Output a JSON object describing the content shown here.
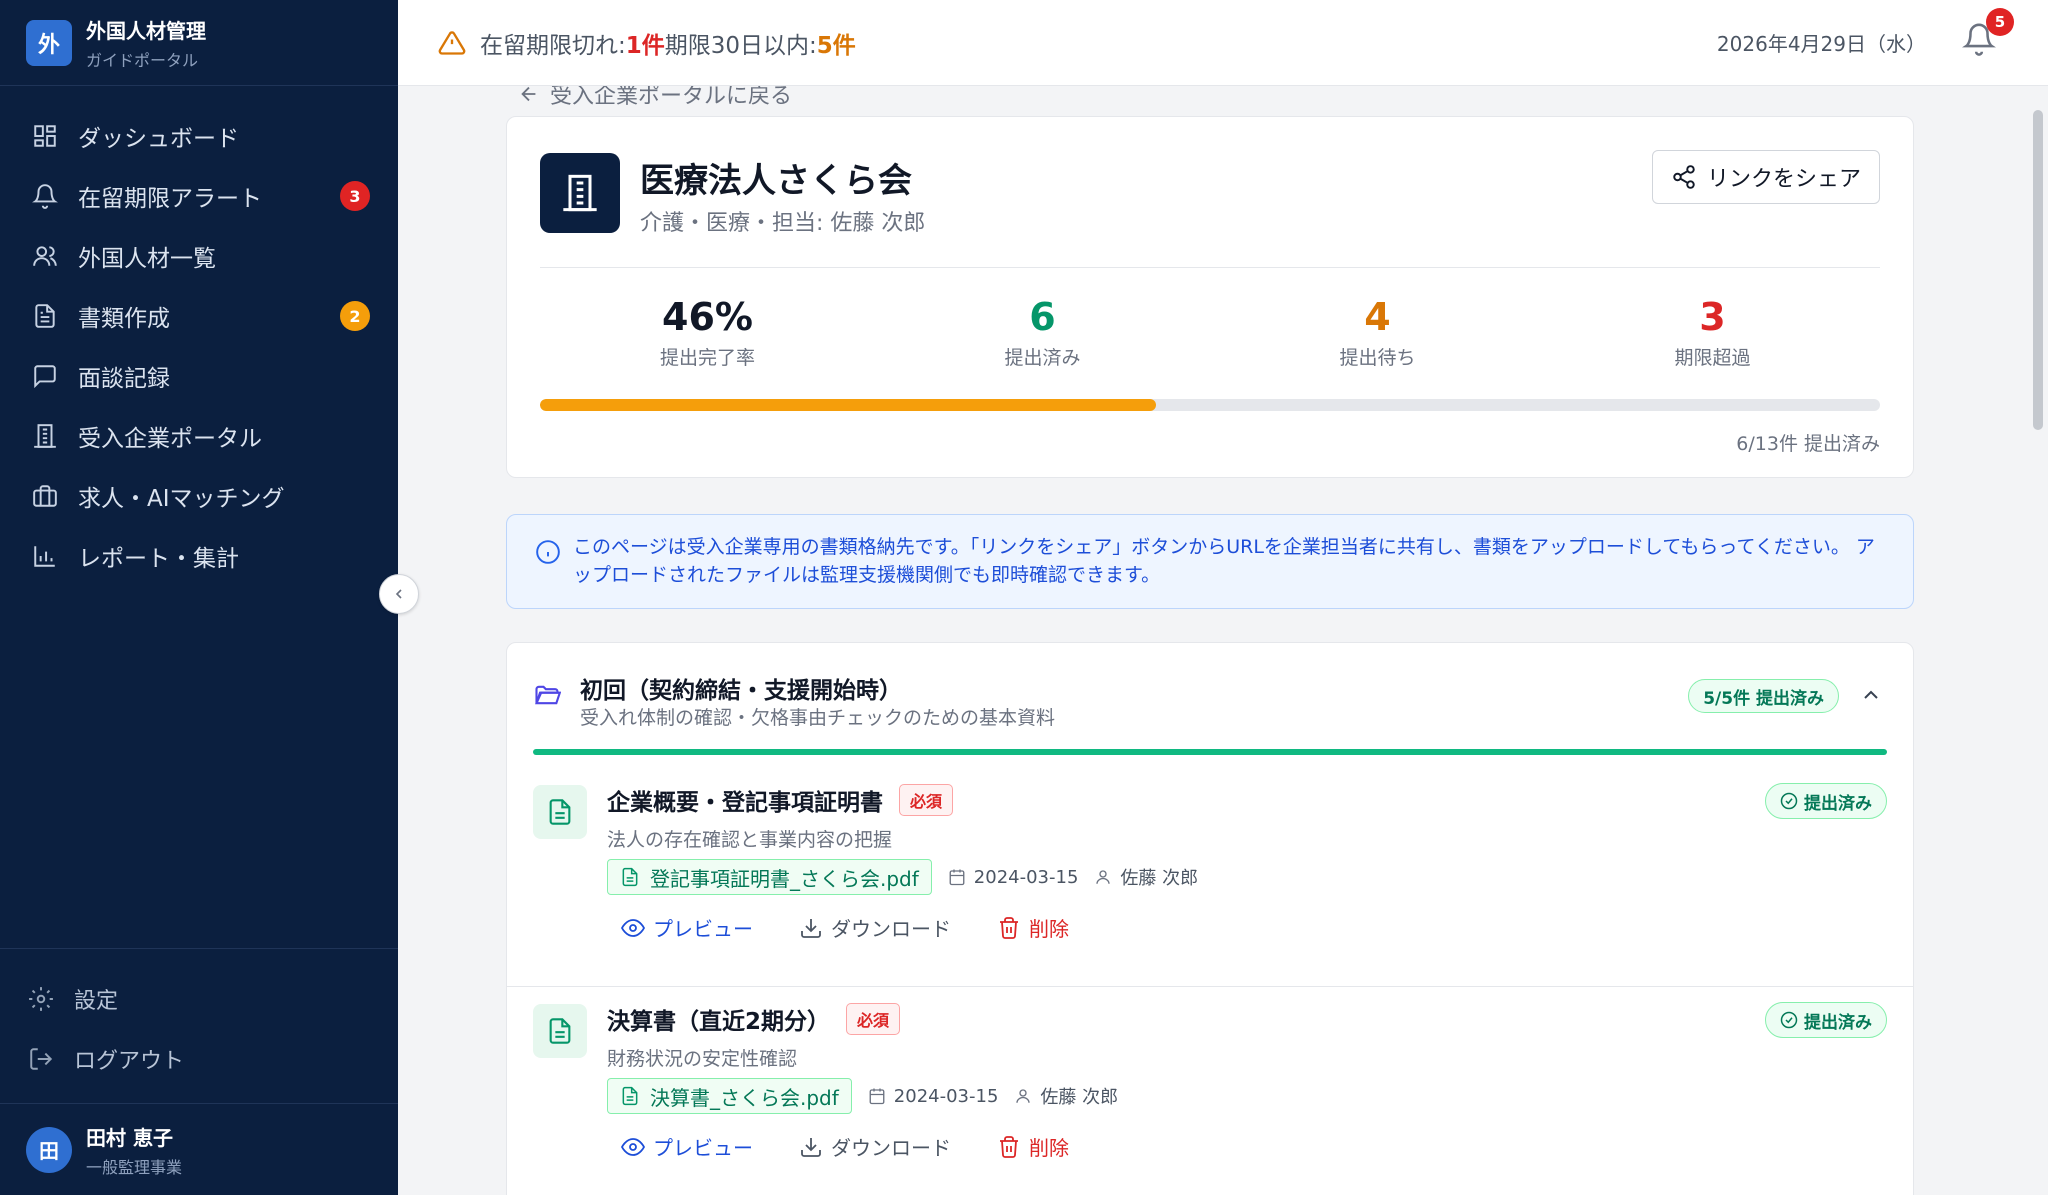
{
  "brand": {
    "logo": "外",
    "title": "外国人材管理",
    "subtitle": "ガイドポータル"
  },
  "sidebar": {
    "items": [
      {
        "label": "ダッシュボード",
        "icon": "dashboard-icon"
      },
      {
        "label": "在留期限アラート",
        "icon": "bell-icon",
        "badge": "3"
      },
      {
        "label": "外国人材一覧",
        "icon": "users-icon"
      },
      {
        "label": "書類作成",
        "icon": "document-icon",
        "badge": "2"
      },
      {
        "label": "面談記録",
        "icon": "chat-icon"
      },
      {
        "label": "受入企業ポータル",
        "icon": "building-icon"
      },
      {
        "label": "求人・AIマッチング",
        "icon": "briefcase-icon"
      },
      {
        "label": "レポート・集計",
        "icon": "chart-icon"
      }
    ],
    "settings": "設定",
    "logout": "ログアウト",
    "user": {
      "initial": "田",
      "name": "田村 恵子",
      "role": "一般監理事業"
    }
  },
  "topbar": {
    "alert_prefix": "在留期限切れ: ",
    "expired": "1件",
    "soon_prefix": "期限30日以内: ",
    "soon": "5件",
    "date": "2026年4月29日（水）",
    "notifications": "5"
  },
  "main": {
    "back_link": "受入企業ポータルに戻る",
    "company": {
      "name": "医療法人さくら会",
      "subtitle": "介護・医療・担当: 佐藤 次郎",
      "share_label": "リンクをシェア"
    },
    "stats": [
      {
        "value": "46%",
        "label": "提出完了率",
        "color": "#111827"
      },
      {
        "value": "6",
        "label": "提出済み",
        "color": "#059669"
      },
      {
        "value": "4",
        "label": "提出待ち",
        "color": "#d97706"
      },
      {
        "value": "3",
        "label": "期限超過",
        "color": "#dc2626"
      }
    ],
    "progress": {
      "percent": 46,
      "caption": "6/13件 提出済み"
    },
    "info": "このページは受入企業専用の書類格納先です。「リンクをシェア」ボタンからURLを企業担当者に共有し、書類をアップロードしてもらってください。 アップロードされたファイルは監理支援機関側でも即時確認できます。",
    "section": {
      "title": "初回（契約締結・支援開始時）",
      "subtitle": "受入れ体制の確認・欠格事由チェックのための基本資料",
      "badge": "5/5件 提出済み",
      "docs": [
        {
          "title": "企業概要・登記事項証明書",
          "required": "必須",
          "desc": "法人の存在確認と事業内容の把握",
          "file": "登記事項証明書_さくら会.pdf",
          "date": "2024-03-15",
          "user": "佐藤 次郎",
          "status": "提出済み"
        },
        {
          "title": "決算書（直近2期分）",
          "required": "必須",
          "desc": "財務状況の安定性確認",
          "file": "決算書_さくら会.pdf",
          "date": "2024-03-15",
          "user": "佐藤 次郎",
          "status": "提出済み"
        }
      ]
    },
    "actions": {
      "preview": "プレビュー",
      "download": "ダウンロード",
      "delete": "削除"
    }
  }
}
